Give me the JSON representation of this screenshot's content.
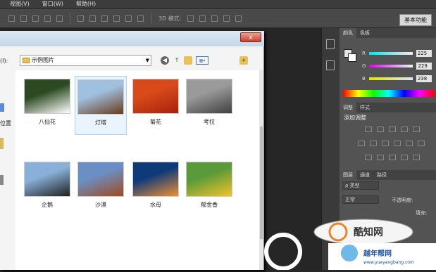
{
  "menu": [
    "视图(V)",
    "窗口(W)",
    "帮助(H)"
  ],
  "options": {
    "mode_3d": "3D 模式:",
    "basic": "基本功能"
  },
  "dialog": {
    "look_in_label": "(I):",
    "location_label": "位置",
    "folder": "示例图片",
    "items": [
      {
        "name": "八仙花",
        "colors": [
          "#2c4a22",
          "#ffffff"
        ]
      },
      {
        "name": "灯塔",
        "colors": [
          "#a0c0e0",
          "#6a3c1a"
        ]
      },
      {
        "name": "菊花",
        "colors": [
          "#d84a1a",
          "#a8200c"
        ]
      },
      {
        "name": "考拉",
        "colors": [
          "#9a9a9a",
          "#404040"
        ]
      },
      {
        "name": "企鹅",
        "colors": [
          "#88b0d8",
          "#202020"
        ]
      },
      {
        "name": "沙漠",
        "colors": [
          "#6a8fc4",
          "#a04a1c"
        ]
      },
      {
        "name": "水母",
        "colors": [
          "#0e3a7a",
          "#f09030"
        ]
      },
      {
        "name": "郁金香",
        "colors": [
          "#5a9a3a",
          "#f2c22a"
        ]
      }
    ],
    "close": "x"
  },
  "panels": {
    "color_tabs": [
      "颜色",
      "色板"
    ],
    "rgb": [
      {
        "ch": "R",
        "value": "225"
      },
      {
        "ch": "G",
        "value": "229"
      },
      {
        "ch": "B",
        "value": "238"
      }
    ],
    "adjust_tabs": [
      "调整",
      "样式"
    ],
    "adjust_title": "添加调整",
    "layer_tabs": [
      "图层",
      "通道",
      "路径"
    ],
    "layer_kind": "ρ 类型",
    "blend_mode": "正常",
    "opacity_label": "不透明度:",
    "fill_label": "填充:"
  },
  "watermark": {
    "brand": "酷知网",
    "url": "www.yueyangbang.com",
    "site": "越年帮网"
  }
}
